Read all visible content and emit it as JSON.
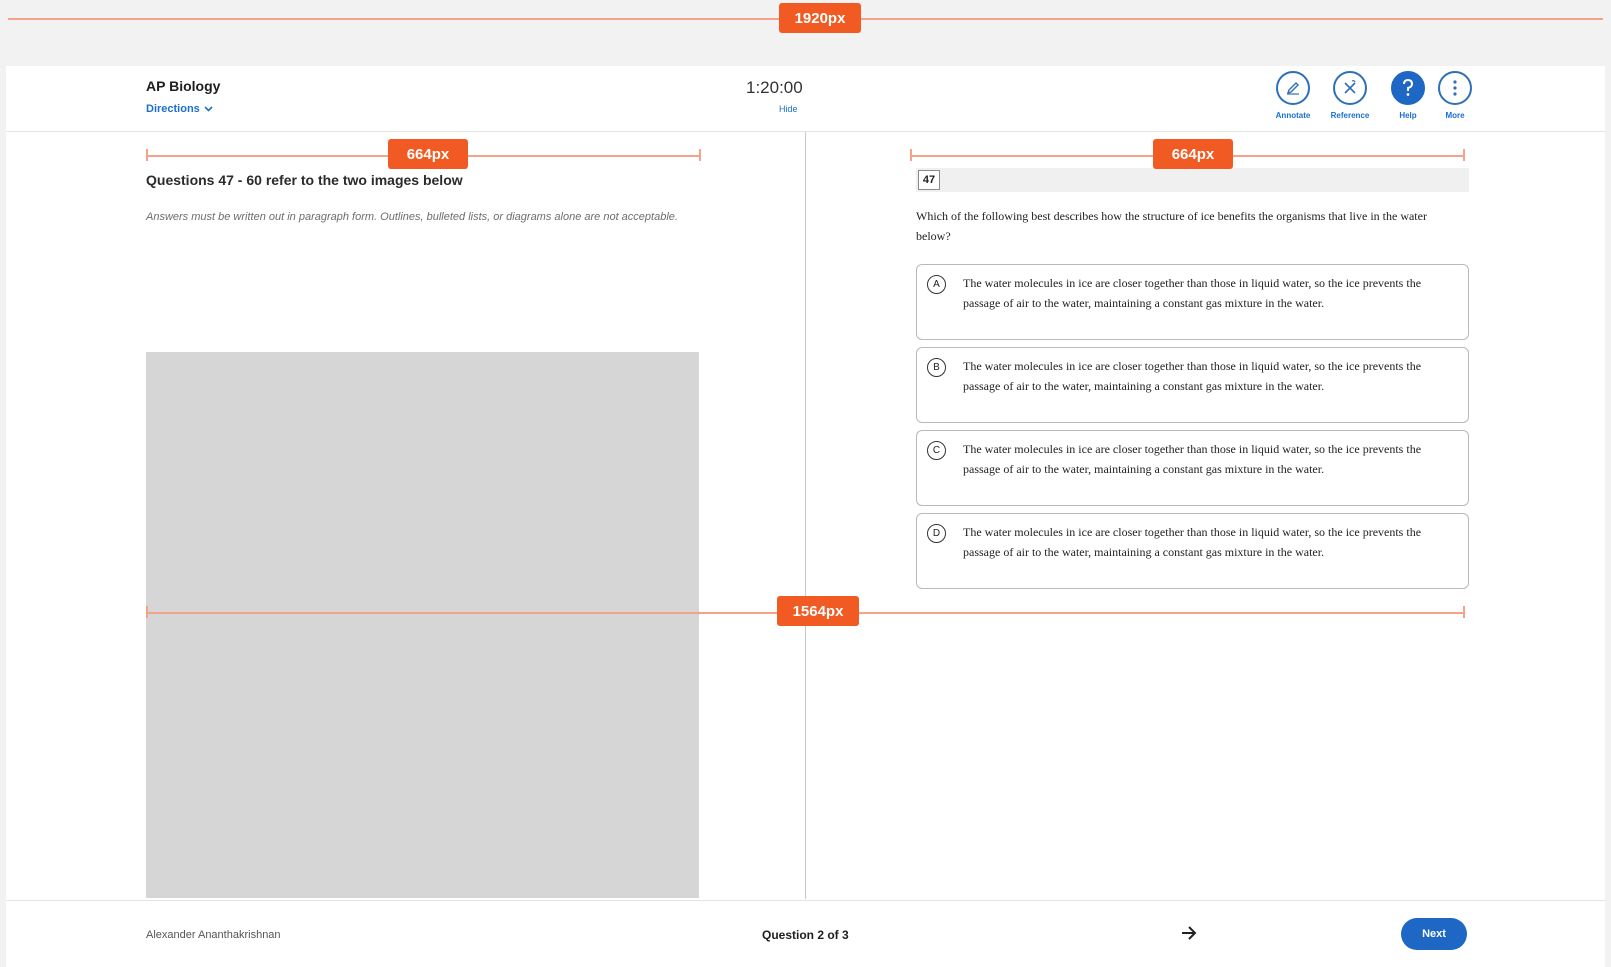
{
  "annotations": {
    "page_width_tag": "1920px",
    "left_column_tag": "664px",
    "right_column_tag": "664px",
    "content_width_tag": "1564px"
  },
  "header": {
    "course_title": "AP Biology",
    "directions_label": "Directions",
    "timer": "1:20:00",
    "timer_hide": "Hide",
    "tools": [
      {
        "label": "Annotate",
        "icon": "pencil-icon"
      },
      {
        "label": "Reference",
        "icon": "formula-icon"
      },
      {
        "label": "Help",
        "icon": "help-icon"
      },
      {
        "label": "More",
        "icon": "more-icon"
      }
    ]
  },
  "left_pane": {
    "heading": "Questions 47 - 60 refer to the two images below",
    "instructions": "Answers must be written out in paragraph form. Outlines, bulleted lists, or diagrams alone are not acceptable."
  },
  "right_pane": {
    "question_number": "47",
    "question_text": "Which of the following best describes how the structure of ice benefits the organisms that live in the water below?",
    "choices": [
      {
        "letter": "A",
        "text": "The water molecules in ice are closer together than those in liquid water, so the ice prevents the passage of air to the water, maintaining a constant gas mixture in the water."
      },
      {
        "letter": "B",
        "text": "The water molecules in ice are closer together than those in liquid water, so the ice prevents the passage of air to the water, maintaining a constant gas mixture in the water."
      },
      {
        "letter": "C",
        "text": "The water molecules in ice are closer together than those in liquid water, so the ice prevents the passage of air to the water, maintaining a constant gas mixture in the water."
      },
      {
        "letter": "D",
        "text": "The water molecules in ice are closer together than those in liquid water, so the ice prevents the passage of air to the water, maintaining a constant gas mixture in the water."
      }
    ]
  },
  "footer": {
    "student_name": "Alexander Ananthakrishnan",
    "question_counter": "Question 2 of 3",
    "next_label": "Next"
  },
  "colors": {
    "accent": "#1e67c4",
    "annotation": "#f15a22"
  }
}
